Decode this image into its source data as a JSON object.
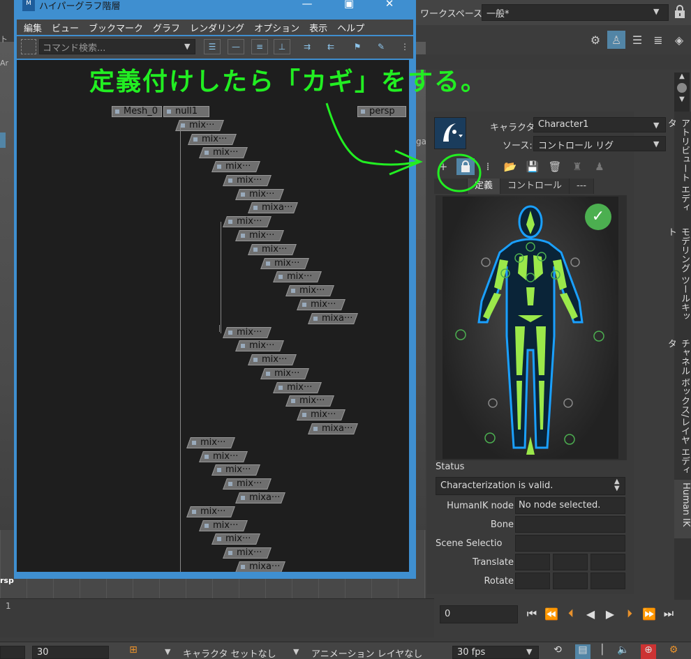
{
  "workspace": {
    "label": "ワークスペース:",
    "value": "一般*"
  },
  "hypergraph": {
    "title": "ハイパーグラフ階層",
    "logo": "M",
    "menu": [
      "編集",
      "ビュー",
      "ブックマーク",
      "グラフ",
      "レンダリング",
      "オプション",
      "表示",
      "ヘルプ"
    ],
    "search_placeholder": "コマンド検索...",
    "nodes": {
      "mesh": "Mesh_0",
      "null1": "null1",
      "persp": "persp",
      "mix": "mix···",
      "mixa": "mixa···"
    }
  },
  "annotation": "定義付けしたら「カギ」をする。",
  "left_fragments": {
    "a": "ト",
    "b": "Ar",
    "persp": "rsp"
  },
  "ga_fragment": "ga",
  "hik": {
    "character_label": "キャラクタ:",
    "character_value": "Character1",
    "source_label": "ソース:",
    "source_value": "コントロール リグ",
    "tabs": [
      "定義",
      "コントロール",
      "---"
    ],
    "status_label": "Status",
    "status_value": "Characterization is valid.",
    "props": [
      {
        "label": "HumanIK node",
        "value": "No node selected."
      },
      {
        "label": "Bone",
        "value": ""
      },
      {
        "label": "Scene Selectio",
        "value": ""
      },
      {
        "label": "Translate",
        "value": ""
      },
      {
        "label": "Rotate",
        "value": ""
      }
    ]
  },
  "side_tabs": [
    "アトリビュート エディタ",
    "モデリング ツールキット",
    "チャネル ボックス/レイヤ エディタ",
    "Human IK"
  ],
  "timeline": {
    "start": "1",
    "current_frame": "0"
  },
  "bottom": {
    "range_end": "30",
    "character_set": "キャラクタ セットなし",
    "anim_layer": "アニメーション レイヤなし",
    "fps": "30 fps"
  },
  "colors": {
    "accent": "#3f8fd0",
    "annotation": "#22ee22",
    "valid": "#4caf50"
  }
}
